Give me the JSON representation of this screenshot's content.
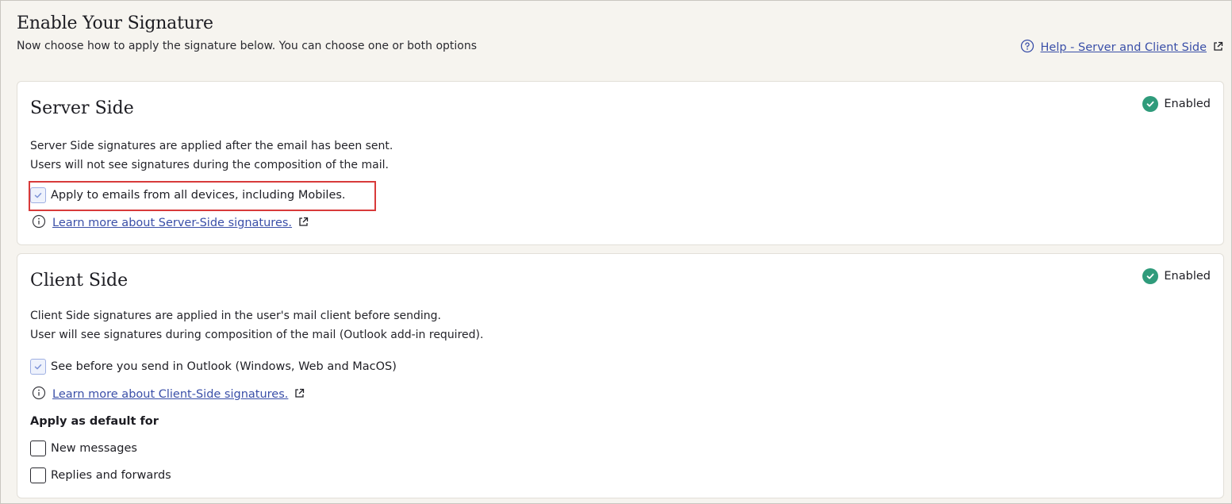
{
  "header": {
    "title": "Enable Your Signature",
    "subtitle": "Now choose how to apply the signature below. You can choose one or both options",
    "help_link": "Help - Server and Client Side",
    "help_icon": "question-circle-icon",
    "external_icon": "external-link-icon"
  },
  "server_side": {
    "title": "Server Side",
    "status": "Enabled",
    "status_icon": "check-circle-icon",
    "description_line1": "Server Side signatures are applied after the email has been sent.",
    "description_line2": "Users will not see signatures during the composition of the mail.",
    "checkbox_label": "Apply to emails from all devices, including Mobiles.",
    "checkbox_checked": true,
    "learn_more": "Learn more about Server-Side signatures.",
    "info_icon": "info-circle-icon"
  },
  "client_side": {
    "title": "Client Side",
    "status": "Enabled",
    "status_icon": "check-circle-icon",
    "description_line1": "Client Side signatures are applied in the user's mail client before sending.",
    "description_line2": "User will see signatures during composition of the mail (Outlook add-in required).",
    "checkbox_label": "See before you send in Outlook (Windows, Web and MacOS)",
    "checkbox_checked": true,
    "learn_more": "Learn more about Client-Side signatures.",
    "info_icon": "info-circle-icon",
    "apply_default_heading": "Apply as default for",
    "default_options": [
      {
        "label": "New messages",
        "checked": false
      },
      {
        "label": "Replies and forwards",
        "checked": false
      }
    ]
  },
  "colors": {
    "background": "#f6f4ef",
    "link": "#3a4fa8",
    "enabled_green": "#2f9b7b",
    "highlight_red": "#d83a3a"
  }
}
